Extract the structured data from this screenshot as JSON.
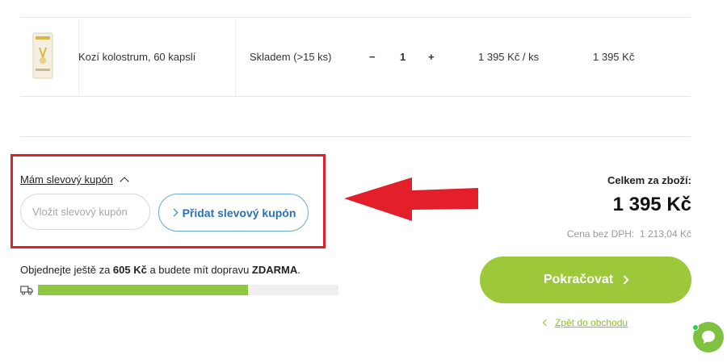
{
  "cart_item": {
    "name": "Kozí kolostrum, 60 kapslí",
    "stock": "Skladem (>15 ks)",
    "qty_minus": "−",
    "qty": "1",
    "qty_plus": "+",
    "unit_price": "1 395 Kč / ks",
    "line_total": "1 395 Kč"
  },
  "coupon": {
    "toggle_label": "Mám slevový kupón",
    "input_placeholder": "Vložit slevový kupón",
    "button_label": "Přidat slevový kupón"
  },
  "shipping": {
    "prefix": "Objednejte ještě za ",
    "amount": "605 Kč",
    "middle": " a budete mít dopravu ",
    "free": "ZDARMA",
    "suffix": ".",
    "progress": 0.7
  },
  "summary": {
    "total_label": "Celkem za zboží:",
    "total_price": "1 395 Kč",
    "net_label": "Cena bez DPH:",
    "net_price": "1 213,04 Kč"
  },
  "actions": {
    "continue_label": "Pokračovat",
    "back_label": "Zpět do obchodu"
  },
  "colors": {
    "accent_green": "#9cc83a",
    "annotation_red": "#e3202a",
    "link_blue": "#2d6fb4"
  }
}
